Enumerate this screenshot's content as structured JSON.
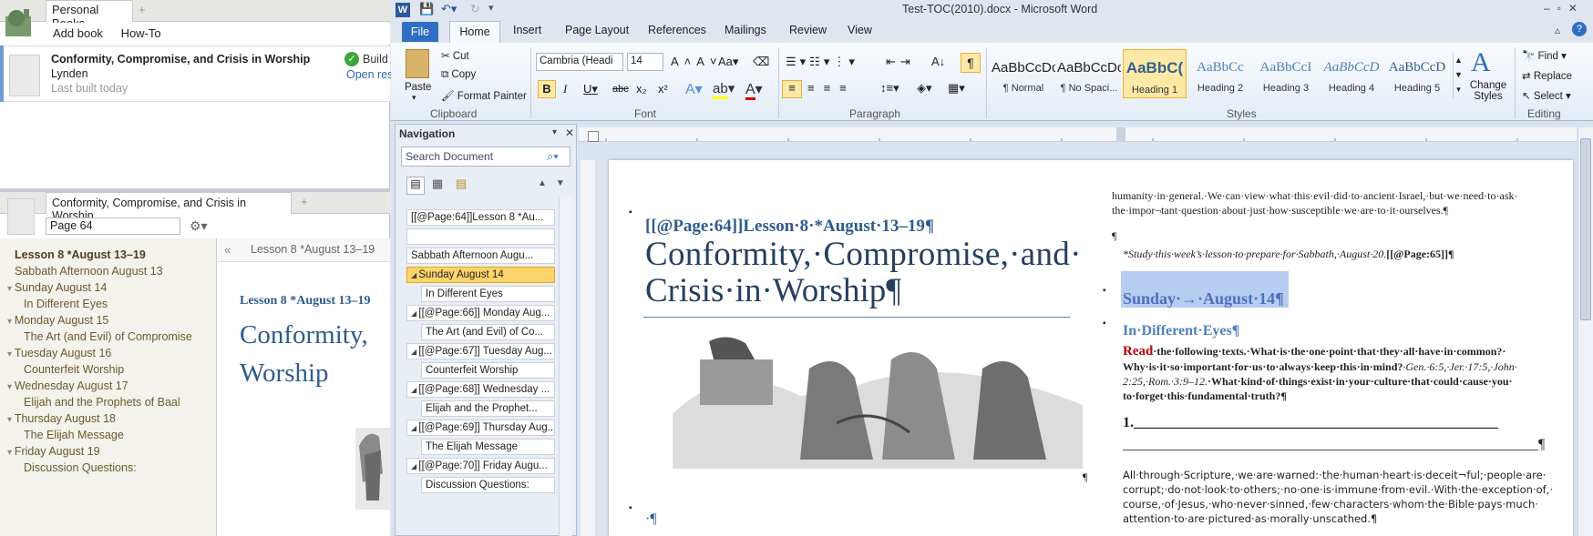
{
  "logos": {
    "app": "logos-app-icon"
  },
  "left": {
    "tab1": "Personal Books",
    "tab_plus": "+",
    "menu": {
      "add_book": "Add book",
      "how_to": "How-To"
    },
    "book": {
      "title": "Conformity, Compromise, and Crisis in Worship",
      "author": "Lynden",
      "status": "Last built today",
      "build": "Build",
      "open": "Open res"
    },
    "tab2": "Conformity, Compromise, and Crisis in Worship",
    "search_value": "Page 64",
    "toc": [
      {
        "label": "Lesson 8 *August 13–19",
        "bold": true,
        "indent": 0,
        "arrow": ""
      },
      {
        "label": "Sabbath Afternoon August 13",
        "bold": false,
        "indent": 0,
        "arrow": ""
      },
      {
        "label": "Sunday August 14",
        "bold": false,
        "indent": 0,
        "arrow": "▾"
      },
      {
        "label": "In Different Eyes",
        "bold": false,
        "indent": 1,
        "arrow": ""
      },
      {
        "label": "Monday August 15",
        "bold": false,
        "indent": 0,
        "arrow": "▾"
      },
      {
        "label": "The Art (and Evil) of Compromise",
        "bold": false,
        "indent": 1,
        "arrow": ""
      },
      {
        "label": "Tuesday August 16",
        "bold": false,
        "indent": 0,
        "arrow": "▾"
      },
      {
        "label": "Counterfeit Worship",
        "bold": false,
        "indent": 1,
        "arrow": ""
      },
      {
        "label": "Wednesday August 17",
        "bold": false,
        "indent": 0,
        "arrow": "▾"
      },
      {
        "label": "Elijah and the Prophets of Baal",
        "bold": false,
        "indent": 1,
        "arrow": ""
      },
      {
        "label": "Thursday August 18",
        "bold": false,
        "indent": 0,
        "arrow": "▾"
      },
      {
        "label": "The Elijah Message",
        "bold": false,
        "indent": 1,
        "arrow": ""
      },
      {
        "label": "Friday August 19",
        "bold": false,
        "indent": 0,
        "arrow": "▾"
      },
      {
        "label": "Discussion Questions:",
        "bold": false,
        "indent": 1,
        "arrow": ""
      }
    ],
    "crumb_back": "«",
    "crumb": "Lesson 8 *August 13–19",
    "preview_lesson": "Lesson 8 *August 13–19",
    "preview_title1": "Conformity,",
    "preview_title2": "Worship"
  },
  "word": {
    "title": "Test-TOC(2010).docx - Microsoft Word",
    "tabs": {
      "file": "File",
      "home": "Home",
      "insert": "Insert",
      "page_layout": "Page Layout",
      "references": "References",
      "mailings": "Mailings",
      "review": "Review",
      "view": "View"
    },
    "clipboard": {
      "paste": "Paste",
      "cut": "Cut",
      "copy": "Copy",
      "format_painter": "Format Painter",
      "label": "Clipboard"
    },
    "font": {
      "name": "Cambria (Headi",
      "size": "14",
      "label": "Font"
    },
    "paragraph_label": "Paragraph",
    "styles": [
      {
        "preview": "AaBbCcDc",
        "name": "¶ Normal",
        "color": "#222222"
      },
      {
        "preview": "AaBbCcDc",
        "name": "¶ No Spaci...",
        "color": "#222222"
      },
      {
        "preview": "AaBbC(",
        "name": "Heading 1",
        "color": "#365f91"
      },
      {
        "preview": "AaBbCc",
        "name": "Heading 2",
        "color": "#4f81bd"
      },
      {
        "preview": "AaBbCcI",
        "name": "Heading 3",
        "color": "#4f81bd"
      },
      {
        "preview": "AaBbCcD",
        "name": "Heading 4",
        "color": "#4f81bd"
      },
      {
        "preview": "AaBbCcD",
        "name": "Heading 5",
        "color": "#365f91"
      }
    ],
    "styles_label": "Styles",
    "change_styles": "Change Styles",
    "editing": {
      "find": "Find",
      "replace": "Replace",
      "select": "Select",
      "label": "Editing"
    },
    "nav": {
      "title": "Navigation",
      "search_placeholder": "Search Document",
      "items": [
        {
          "label": "[[@Page:64]]Lesson 8 *Au...",
          "sub": false,
          "sel": false,
          "arrow": ""
        },
        {
          "label": "",
          "sub": false,
          "sel": false,
          "arrow": ""
        },
        {
          "label": "Sabbath Afternoon  Augu...",
          "sub": false,
          "sel": false,
          "arrow": ""
        },
        {
          "label": "Sunday  August 14",
          "sub": false,
          "sel": true,
          "arrow": "◢"
        },
        {
          "label": "In Different Eyes",
          "sub": true,
          "sel": false,
          "arrow": ""
        },
        {
          "label": "[[@Page:66]] Monday  Aug...",
          "sub": false,
          "sel": false,
          "arrow": "◢"
        },
        {
          "label": "The Art (and Evil) of Co...",
          "sub": true,
          "sel": false,
          "arrow": ""
        },
        {
          "label": "[[@Page:67]] Tuesday  Aug...",
          "sub": false,
          "sel": false,
          "arrow": "◢"
        },
        {
          "label": "Counterfeit Worship",
          "sub": true,
          "sel": false,
          "arrow": ""
        },
        {
          "label": "[[@Page:68]] Wednesday ...",
          "sub": false,
          "sel": false,
          "arrow": "◢"
        },
        {
          "label": "Elijah and the Prophet...",
          "sub": true,
          "sel": false,
          "arrow": ""
        },
        {
          "label": "[[@Page:69]] Thursday  Aug...",
          "sub": false,
          "sel": false,
          "arrow": "◢"
        },
        {
          "label": "The Elijah Message",
          "sub": true,
          "sel": false,
          "arrow": ""
        },
        {
          "label": "[[@Page:70]] Friday  Augu...",
          "sub": false,
          "sel": false,
          "arrow": "◢"
        },
        {
          "label": "Discussion Questions:",
          "sub": true,
          "sel": false,
          "arrow": ""
        }
      ]
    },
    "doc": {
      "lesson": "[[@Page:64]]Lesson·8·*August·13–19¶",
      "title1": "Conformity,·Compromise,·and·",
      "title2": "Crisis·in·Worship¶",
      "pilcrow1": "¶",
      "bottom": "·¶",
      "r1": "humanity·in·general.·We·can·view·what·this·evil·did·to·ancient·Israel,·but·we·need·to·ask·",
      "r2": "the·impor¬tant·question·about·just·how·susceptible·we·are·to·it·ourselves.¶",
      "r3": "¶",
      "r4": "*Study·this·week’s·lesson·to·prepare·for·Sabbath,·August·20.",
      "r4b": "[[@Page:65]]¶",
      "sunday": "Sunday·→·August·14¶",
      "diff": "In·Different·Eyes¶",
      "read": "Read",
      "q1": "·the·following·texts.·What·is·the·one·point·that·they·all·have·in·common?·",
      "q2a": "Why·is·it·so·important·for·us·to·always·keep·this·in·mind?",
      "q2b": "·Gen.·6:5,·Jer.·17:5,·John·",
      "q3a": "2:25,·Rom.·3:9–12.",
      "q3b": "·What·kind·of·things·exist·in·your·culture·that·could·cause·you·",
      "q4": "to·forget·this·fundamental·truth?¶",
      "ans1": "1.__________________________________________________",
      "ans2": "_________________________________________________________¶",
      "p1": "All·through·Scripture,·we·are·warned:·the·human·heart·is·deceit¬ful;·people·are·",
      "p2": "corrupt;·do·not·look·to·others;·no·one·is·immune·from·evil.·With·the·exception·of,·",
      "p3": "course,·of·Jesus,·who·never·sinned,·few·characters·whom·the·Bible·pays·much·",
      "p4": "attention·to·are·pictured·as·morally·unscathed.¶"
    }
  }
}
